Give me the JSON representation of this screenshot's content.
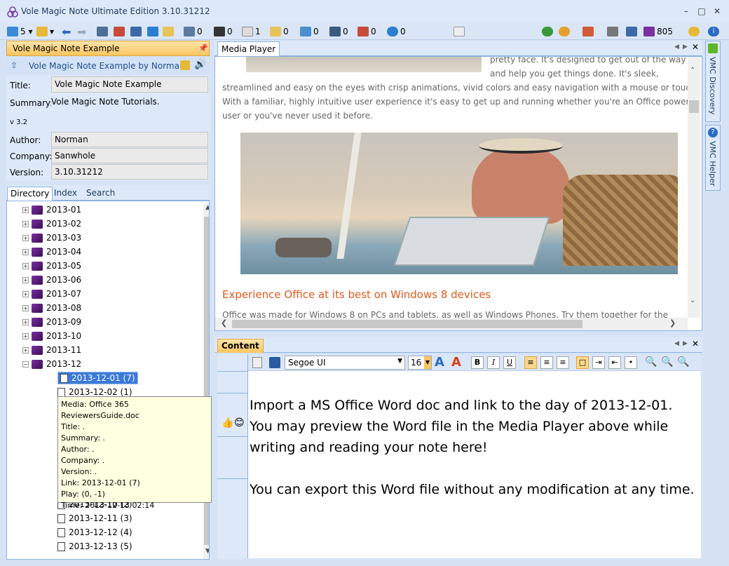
{
  "window": {
    "title": "Vole Magic Note  Ultimate Edition  3.10.31212"
  },
  "toolbar": {
    "counts": [
      "5",
      "0",
      "0",
      "1",
      "0",
      "0",
      "0",
      "0",
      "0",
      "805"
    ]
  },
  "left": {
    "header_title": "Vole Magic Note Example",
    "author_line": "Vole Magic Note Example by Norman",
    "title_label": "Title:",
    "title_value": "Vole Magic Note Example",
    "summary_label": "Summary:",
    "summary_value": "Vole Magic Note Tutorials.",
    "version_small": "v 3.2",
    "author_label": "Author:",
    "author_value": "Norman",
    "company_label": "Company:",
    "company_value": "Sanwhole",
    "version_label": "Version:",
    "version_value": "3.10.31212",
    "tabs": [
      "Directory",
      "Index",
      "Search"
    ]
  },
  "tree": {
    "months": [
      "2013-01",
      "2013-02",
      "2013-03",
      "2013-04",
      "2013-05",
      "2013-06",
      "2013-07",
      "2013-08",
      "2013-09",
      "2013-10",
      "2013-11",
      "2013-12"
    ],
    "days_top": [
      "2013-12-01 (7)",
      "2013-12-02 (1)"
    ],
    "days_bottom": [
      "2013-12-10 (2)",
      "2013-12-11 (3)",
      "2013-12-12 (4)",
      "2013-12-13 (5)"
    ]
  },
  "tooltip": {
    "lines": [
      "Media: Office 365 ReviewersGuide.doc",
      "Title: .",
      "Summary: .",
      "Author: .",
      "Company: .",
      "Version: .",
      "Link: 2013-12-01 (7)",
      "Play: (0, -1)",
      "Time: 2013-12-13 02:14"
    ]
  },
  "media_player": {
    "tab": "Media Player",
    "para1_a": "pretty face. It's designed to get out of the way",
    "para1_b": "and help you get things done. It's sleek,",
    "para1_c": "streamlined and easy on the eyes with crisp animations, vivid colors and easy navigation with a mouse or touch.",
    "para1_d": "With a familiar, highly intuitive user experience it's easy to get up and running whether you're an Office power",
    "para1_e": "user or you've never used it before.",
    "heading": "Experience Office at its best on Windows 8 devices",
    "para2": "Office was made for Windows 8 on PCs and tablets, as well as Windows Phones. Try them together for the"
  },
  "side": {
    "discovery": "VMC Discovery",
    "helper": "VMC Helper"
  },
  "content": {
    "tab": "Content",
    "font": "Segoe UI",
    "size": "16",
    "line1": "Import a MS Office Word doc and link to the day of 2013-12-01. You may preview the Word file in the Media Player above while writing and reading your note here!",
    "line2": "You can export this Word file without any modification at any time."
  }
}
